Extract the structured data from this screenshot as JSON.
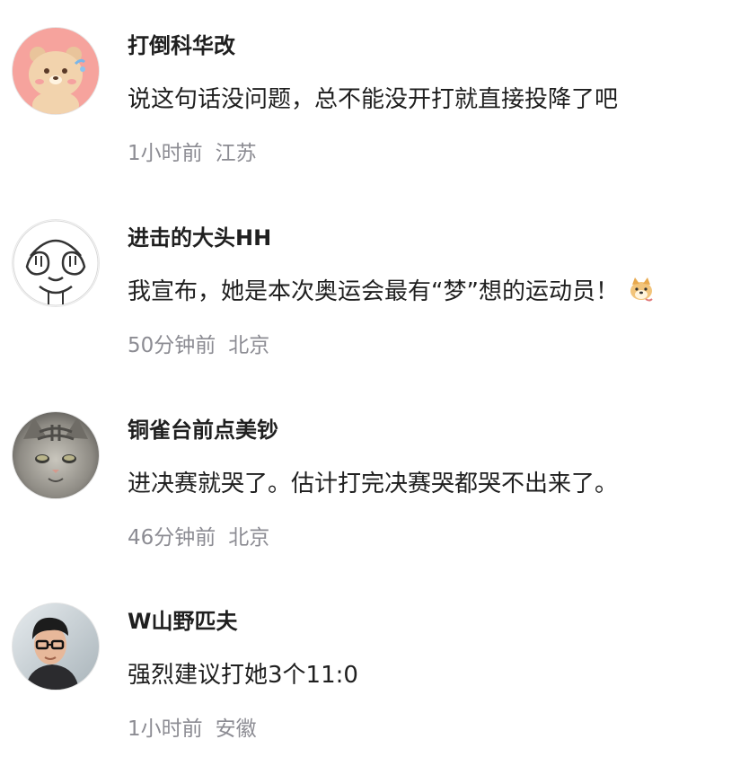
{
  "comments": [
    {
      "avatar_icon": "cartoon-bear-avatar",
      "username": "打倒科华改",
      "content": "说这句话没问题，总不能没开打就直接投降了吧",
      "time": "1小时前",
      "location": "江苏"
    },
    {
      "avatar_icon": "covering-eyes-cartoon-avatar",
      "username": "进击的大头HH",
      "content": "我宣布，她是本次奥运会最有“梦”想的运动员！",
      "emoji_icon": "doge-emoji",
      "time": "50分钟前",
      "location": "北京"
    },
    {
      "avatar_icon": "tabby-cat-avatar",
      "username": "铜雀台前点美钞",
      "content": "进决赛就哭了。估计打完决赛哭都哭不出来了。",
      "time": "46分钟前",
      "location": "北京"
    },
    {
      "avatar_icon": "man-with-glasses-avatar",
      "username": "W山野匹夫",
      "content": "强烈建议打她3个11:0",
      "time": "1小时前",
      "location": "安徽"
    }
  ]
}
